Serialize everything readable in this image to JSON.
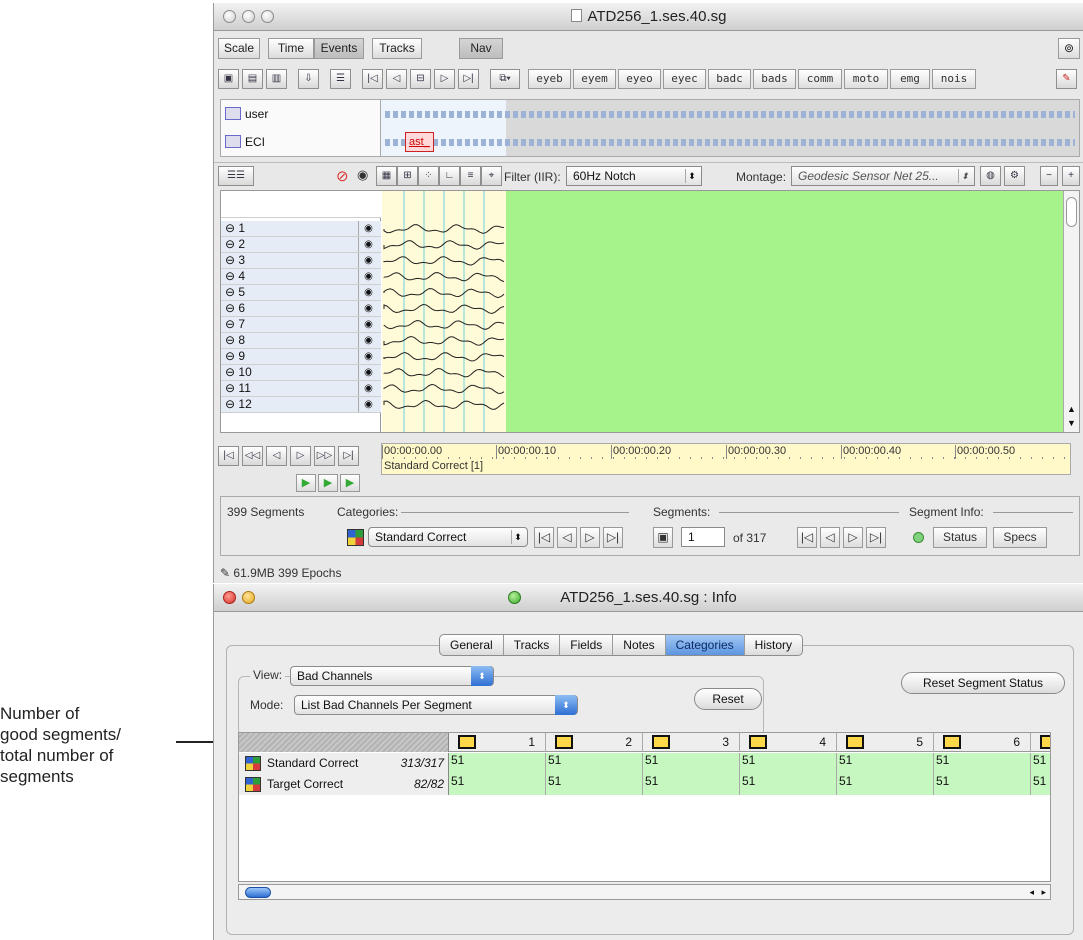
{
  "annotation": {
    "lines": [
      "Number of",
      "good segments/",
      "total number of",
      "segments"
    ]
  },
  "main_window": {
    "title": "ATD256_1.ses.40.sg",
    "toolbar_buttons": [
      "Scale",
      "Time",
      "Events",
      "Tracks",
      "Nav"
    ],
    "event_buttons": [
      "eyeb",
      "eyem",
      "eyeo",
      "eyec",
      "badc",
      "bads",
      "comm",
      "moto",
      "emg",
      "nois"
    ],
    "tracks": [
      {
        "name": "user"
      },
      {
        "name": "ECI",
        "event_label": "ast_"
      }
    ],
    "filter_label": "Filter (IIR):",
    "filter_value": "60Hz Notch",
    "montage_label": "Montage:",
    "montage_value": "Geodesic Sensor Net 25...",
    "channels": [
      "1",
      "2",
      "3",
      "4",
      "5",
      "6",
      "7",
      "8",
      "9",
      "10",
      "11",
      "12"
    ],
    "timeline": {
      "ticks": [
        "00:00:00.00",
        "00:00:00.10",
        "00:00:00.20",
        "00:00:00.30",
        "00:00:00.40",
        "00:00:00.50"
      ],
      "category": "Standard Correct [1]"
    },
    "segments_count": "399 Segments",
    "categories_label": "Categories:",
    "category_value": "Standard Correct",
    "segments_label": "Segments:",
    "segment_number": "1",
    "segment_of": "of 317",
    "segment_info_label": "Segment Info:",
    "status_button": "Status",
    "specs_button": "Specs",
    "status_bar": "61.9MB  399 Epochs"
  },
  "info_window": {
    "title": "ATD256_1.ses.40.sg : Info",
    "tabs": [
      "General",
      "Tracks",
      "Fields",
      "Notes",
      "Categories",
      "History"
    ],
    "active_tab": "Categories",
    "view_label": "View:",
    "view_value": "Bad Channels",
    "mode_label": "Mode:",
    "mode_value": "List Bad Channels Per Segment",
    "reset_button": "Reset",
    "reset_segment_status_button": "Reset Segment Status",
    "columns": [
      "1",
      "2",
      "3",
      "4",
      "5",
      "6"
    ],
    "rows": [
      {
        "name": "Standard Correct",
        "ratio": "313/317",
        "values": [
          "51",
          "51",
          "51",
          "51",
          "51",
          "51",
          "51"
        ]
      },
      {
        "name": "Target Correct",
        "ratio": "82/82",
        "values": [
          "51",
          "51",
          "51",
          "51",
          "51",
          "51",
          "51"
        ]
      }
    ]
  }
}
